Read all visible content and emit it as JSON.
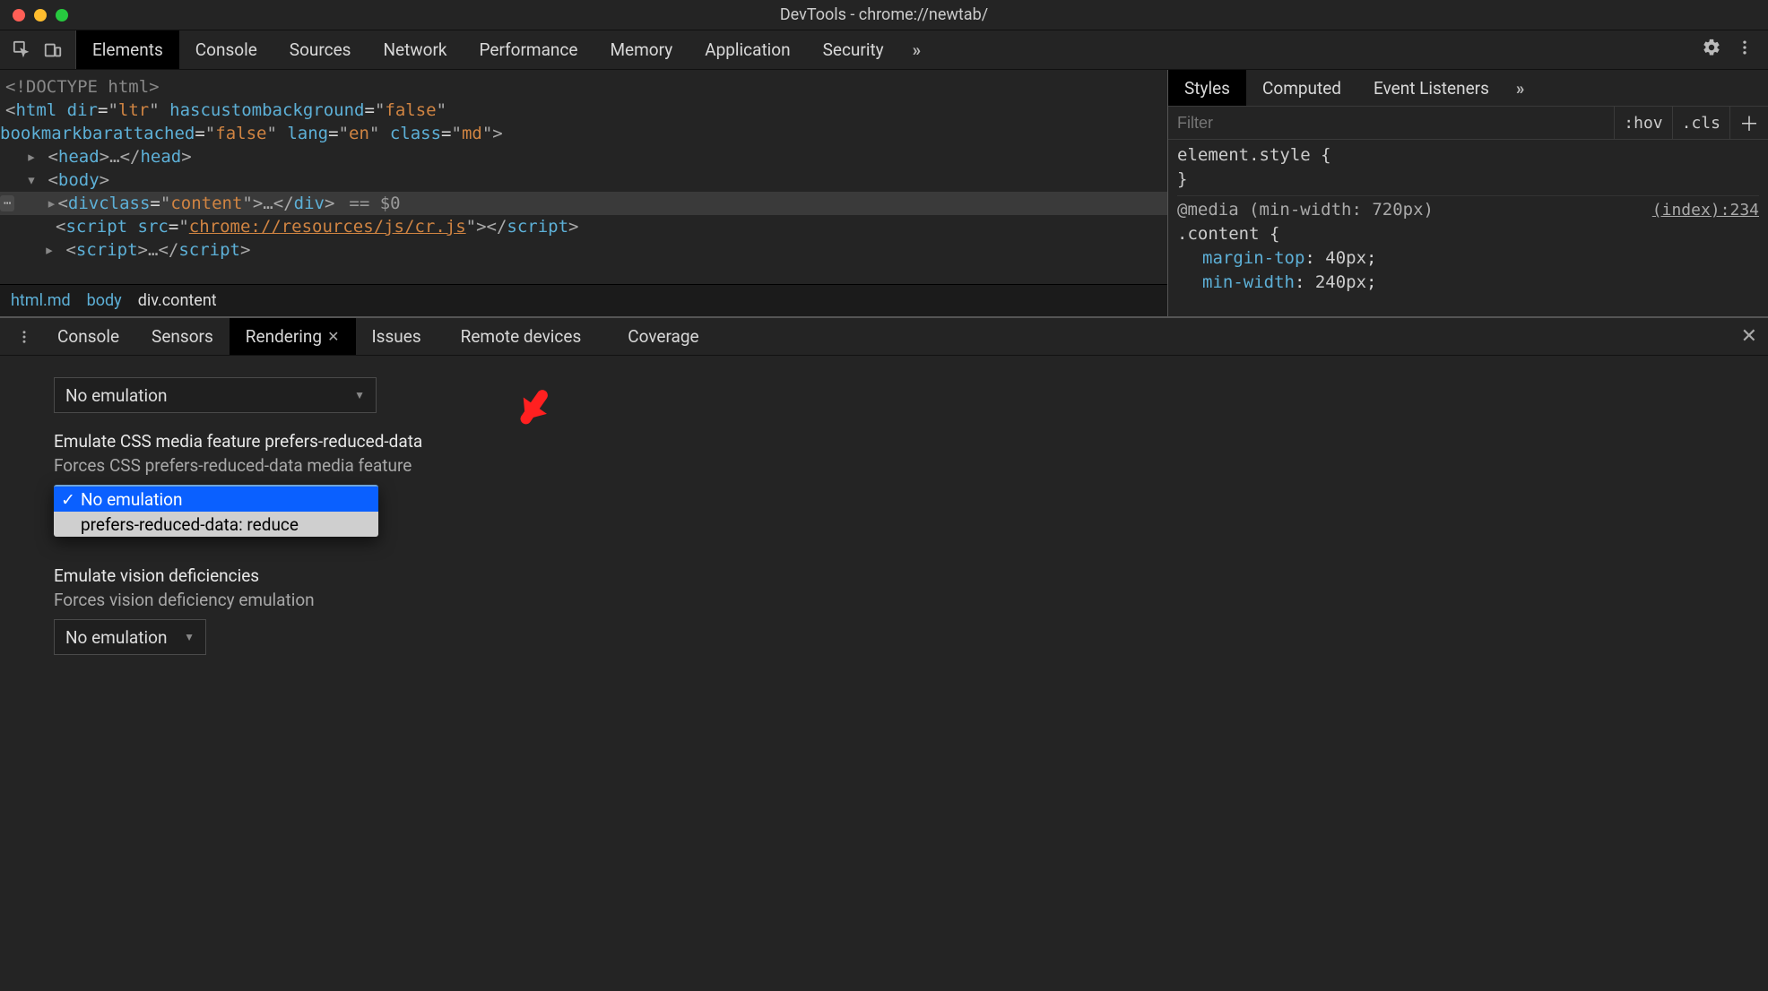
{
  "window": {
    "title": "DevTools - chrome://newtab/"
  },
  "mainTabs": {
    "items": [
      "Elements",
      "Console",
      "Sources",
      "Network",
      "Performance",
      "Memory",
      "Application",
      "Security"
    ],
    "activeIndex": 0
  },
  "dom": {
    "doctype": "<!DOCTYPE html>",
    "html_open": {
      "tag": "html",
      "attrs": [
        [
          "dir",
          "ltr"
        ],
        [
          "hascustombackground",
          "false"
        ],
        [
          "bookmarkbarattached",
          "false"
        ],
        [
          "lang",
          "en"
        ],
        [
          "class",
          "md"
        ]
      ]
    },
    "head_collapsed": "head",
    "body_tag": "body",
    "content_div": {
      "tag": "div",
      "attrs": [
        [
          "class",
          "content"
        ]
      ],
      "dollar": "== $0"
    },
    "script1": {
      "tag": "script",
      "attrs": [
        [
          "src",
          "chrome://resources/js/cr.js"
        ]
      ]
    },
    "script2_collapsed": "script"
  },
  "breadcrumb": {
    "items": [
      "html.md",
      "body",
      "div.content"
    ],
    "activeIndex": 2
  },
  "stylesTabs": {
    "items": [
      "Styles",
      "Computed",
      "Event Listeners"
    ],
    "activeIndex": 0
  },
  "stylesFilter": {
    "placeholder": "Filter",
    "hov": ":hov",
    "cls": ".cls"
  },
  "stylesBody": {
    "elementStyle": "element.style {",
    "closeBrace": "}",
    "media": "@media (min-width: 720px)",
    "selector": ".content {",
    "sourceLink": "(index):234",
    "props": [
      {
        "name": "margin-top",
        "value": "40px"
      },
      {
        "name": "min-width",
        "value": "240px"
      }
    ]
  },
  "drawerTabs": {
    "items": [
      "Console",
      "Sensors",
      "Rendering",
      "Issues",
      "Remote devices",
      "Coverage"
    ],
    "activeIndex": 2
  },
  "rendering": {
    "topSelect": "No emulation",
    "section1": {
      "title": "Emulate CSS media feature prefers-reduced-data",
      "desc": "Forces CSS prefers-reduced-data media feature",
      "options": [
        "No emulation",
        "prefers-reduced-data: reduce"
      ],
      "selectedIndex": 0
    },
    "section2": {
      "title": "Emulate vision deficiencies",
      "desc": "Forces vision deficiency emulation",
      "select": "No emulation"
    }
  }
}
